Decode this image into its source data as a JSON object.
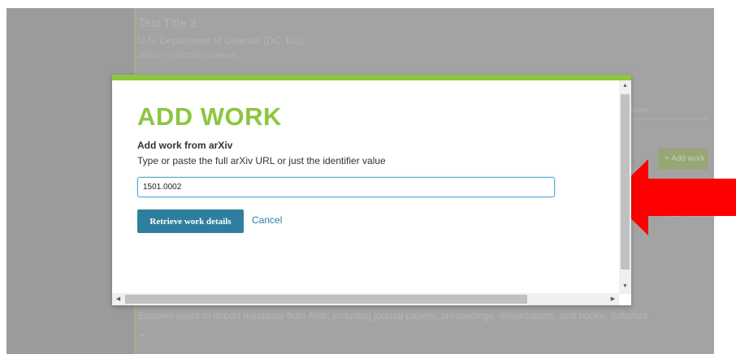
{
  "background": {
    "record_title": "Test Title 2",
    "record_org": "U.S. Department of Defense (DC, DC)",
    "record_meta": "2019-07 to 2022-06 | Contract",
    "source_label": "Source",
    "add_button_label": "+ Add work",
    "user_records_label": "user records",
    "description": "Enables users to import metadata from Airiti, including journal papers, proceedings, dissertations, and books. Scholars",
    "chevron": "⌄"
  },
  "modal": {
    "title": "ADD WORK",
    "section_heading": "Add work from arXiv",
    "section_help": "Type or paste the full arXiv URL or just the identifier value",
    "input_value": "1501.0002",
    "retrieve_label": "Retrieve work details",
    "cancel_label": "Cancel"
  },
  "colors": {
    "accent_green": "#8cc63f",
    "button_blue": "#2e7f9f",
    "arrow_red": "#ff0000"
  }
}
